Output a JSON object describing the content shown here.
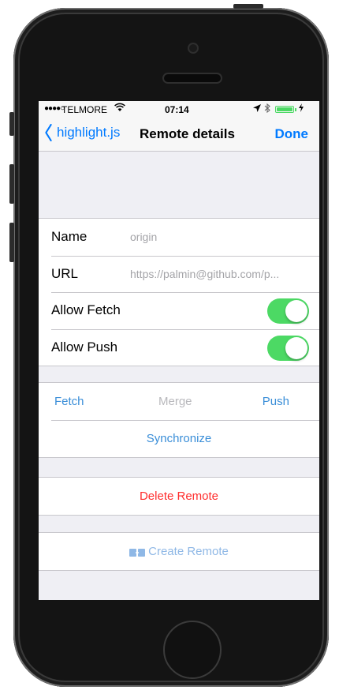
{
  "status_bar": {
    "signal": "●●●●○",
    "carrier": "TELMORE",
    "wifi_icon": "wifi-icon",
    "time": "07:14",
    "battery_level": 0.9
  },
  "nav": {
    "back_label": "highlight.js",
    "title": "Remote details",
    "done_label": "Done"
  },
  "details": {
    "name_label": "Name",
    "name_value": "origin",
    "url_label": "URL",
    "url_value": "https://palmin@github.com/p...",
    "allow_fetch_label": "Allow Fetch",
    "allow_fetch": true,
    "allow_push_label": "Allow Push",
    "allow_push": true
  },
  "actions": {
    "fetch_label": "Fetch",
    "merge_label": "Merge",
    "push_label": "Push",
    "synchronize_label": "Synchronize",
    "delete_label": "Delete Remote",
    "create_label": "Create Remote"
  },
  "colors": {
    "accent": "#007aff",
    "toggle_on": "#4cd964",
    "destructive": "#ff2d2d",
    "background": "#efeff4"
  }
}
